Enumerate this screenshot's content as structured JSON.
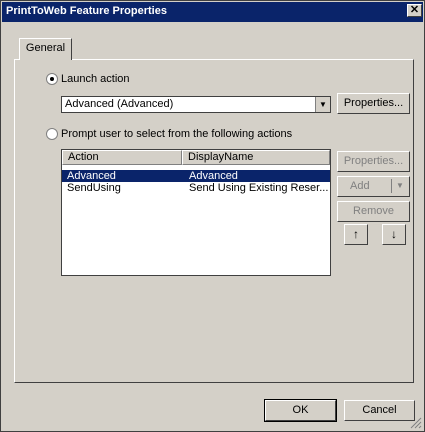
{
  "window": {
    "title": "PrintToWeb Feature Properties",
    "close_glyph": "✕"
  },
  "tabs": [
    {
      "label": "General"
    }
  ],
  "launch": {
    "radio_label": "Launch action",
    "selected_value": "Advanced (Advanced)",
    "properties_label": "Properties..."
  },
  "prompt": {
    "radio_label": "Prompt user to select from the following actions",
    "columns": [
      "Action",
      "DisplayName"
    ],
    "rows": [
      {
        "action": "Advanced",
        "display": "Advanced"
      },
      {
        "action": "SendUsing",
        "display": "Send Using Existing Reser..."
      }
    ],
    "buttons": {
      "properties": "Properties...",
      "add": "Add",
      "remove": "Remove",
      "up": "↑",
      "down": "↓"
    }
  },
  "footer": {
    "ok": "OK",
    "cancel": "Cancel"
  },
  "colors": {
    "face": "#d4d0c8",
    "titlebar": "#0a246a",
    "selection": "#0a246a"
  }
}
